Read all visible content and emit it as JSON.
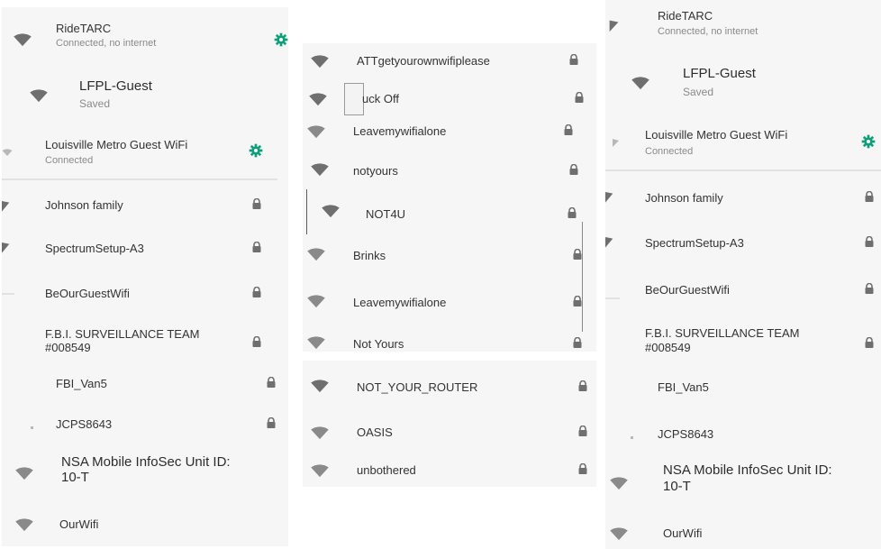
{
  "colors": {
    "accent": "#0e9e7a",
    "icon": "#6f6f6f",
    "lock": "#6f6f6f",
    "panel": "#f6f6f6",
    "divider": "#e2e2e2"
  },
  "left": {
    "networks": [
      {
        "name": "RideTARC",
        "status": "Connected, no internet",
        "trailing": "gear-icon"
      },
      {
        "name": "LFPL-Guest",
        "status": "Saved",
        "trailing": "none"
      },
      {
        "name": "Louisville Metro Guest WiFi",
        "status": "Connected",
        "trailing": "gear-icon"
      },
      {
        "name": "Johnson family",
        "trailing": "lock-icon"
      },
      {
        "name": "SpectrumSetup-A3",
        "trailing": "lock-icon"
      },
      {
        "name": "BeOurGuestWifi",
        "trailing": "lock-icon"
      },
      {
        "name": "F.B.I. SURVEILLANCE TEAM",
        "name2": "#008549",
        "trailing": "lock-icon"
      },
      {
        "name": "FBI_Van5",
        "trailing": "lock-icon"
      },
      {
        "name": "JCPS8643",
        "trailing": "lock-icon"
      },
      {
        "name": "NSA Mobile InfoSec Unit ID:",
        "name2": "10-T",
        "trailing": "none"
      },
      {
        "name": "OurWifi",
        "trailing": "none"
      }
    ]
  },
  "middle_top": {
    "networks": [
      {
        "name": "ATTgetyourownwifiplease",
        "trailing": "lock-icon"
      },
      {
        "name": "uck Off",
        "trailing": "lock-icon"
      },
      {
        "name": "Leavemywifialone",
        "trailing": "lock-icon"
      },
      {
        "name": "notyours",
        "trailing": "lock-icon"
      },
      {
        "name": "NOT4U",
        "trailing": "lock-icon"
      },
      {
        "name": "Brinks",
        "trailing": "lock-icon"
      },
      {
        "name": "Leavemywifialone",
        "trailing": "lock-icon"
      },
      {
        "name": "Not Yours",
        "trailing": "lock-icon"
      }
    ]
  },
  "middle_bottom": {
    "networks": [
      {
        "name": "NOT_YOUR_ROUTER",
        "trailing": "lock-icon"
      },
      {
        "name": "OASIS",
        "trailing": "lock-icon"
      },
      {
        "name": "unbothered",
        "trailing": "lock-icon"
      }
    ]
  },
  "right": {
    "networks": [
      {
        "name": "RideTARC",
        "status": "Connected, no internet",
        "trailing": "none"
      },
      {
        "name": "LFPL-Guest",
        "status": "Saved",
        "trailing": "none"
      },
      {
        "name": "Louisville Metro Guest WiFi",
        "status": "Connected",
        "trailing": "gear-icon"
      },
      {
        "name": "Johnson family",
        "trailing": "lock-icon"
      },
      {
        "name": "SpectrumSetup-A3",
        "trailing": "lock-icon"
      },
      {
        "name": "BeOurGuestWifi",
        "trailing": "lock-icon"
      },
      {
        "name": "F.B.I. SURVEILLANCE TEAM",
        "name2": "#008549",
        "trailing": "lock-icon"
      },
      {
        "name": "FBI_Van5",
        "trailing": "none"
      },
      {
        "name": "JCPS8643",
        "trailing": "none"
      },
      {
        "name": "NSA Mobile InfoSec Unit ID:",
        "name2": "10-T",
        "trailing": "none"
      },
      {
        "name": "OurWifi",
        "trailing": "none"
      }
    ]
  }
}
